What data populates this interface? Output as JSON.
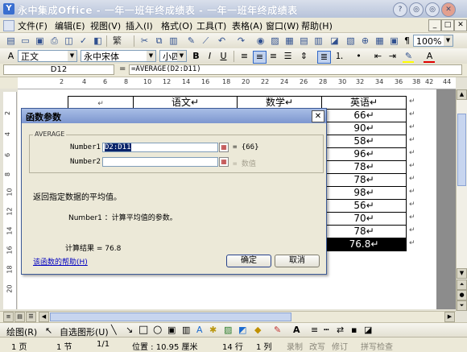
{
  "window": {
    "title": "永中集成Office - 一年一班年终成绩表 - 一年一班年终成绩表",
    "buttons": [
      "?",
      "◎",
      "◎",
      "✕"
    ]
  },
  "menubar": {
    "items": [
      "文件(F)",
      "编辑(E)",
      "视图(V)",
      "插入(I)",
      "格式(O)",
      "工具(T)",
      "表格(A)",
      "窗口(W)",
      "帮助(H)"
    ]
  },
  "toolbar": {
    "zoom": "100%",
    "style": "正文",
    "font": "永中宋体",
    "size": "小四"
  },
  "formula_bar": {
    "cell_ref": "D12",
    "equals": "=",
    "formula": "=AVERAGE(D2:D11)"
  },
  "ruler": {
    "numbers": [
      "2",
      "4",
      "6",
      "8",
      "10",
      "12",
      "14",
      "16",
      "18",
      "20",
      "22",
      "24",
      "26",
      "28",
      "30",
      "32",
      "34",
      "36",
      "38",
      "42",
      "44"
    ],
    "vnumbers": [
      "2",
      "4",
      "6",
      "8",
      "10",
      "12",
      "14",
      "16",
      "18",
      "20"
    ]
  },
  "table": {
    "header": [
      "↵",
      "语文↵",
      "数学↵",
      "英语↵"
    ],
    "english_scores": [
      "66↵",
      "90↵",
      "58↵",
      "96↵",
      "78↵",
      "78↵",
      "98↵",
      "56↵",
      "70↵",
      "78↵"
    ],
    "result": "76.8↵"
  },
  "dialog": {
    "title": "函数参数",
    "close": "✕",
    "function_name": "AVERAGE",
    "arg1_label": "Number1",
    "arg1_value": "D2:D11",
    "arg1_result": "= {66}",
    "arg2_label": "Number2",
    "arg2_result": "= 数值",
    "description": "返回指定数据的平均值。",
    "arg_description": "Number1 ：计算平均值的参数。",
    "result_label": "计算结果 = 76.8",
    "help_link": "该函数的帮助(H)",
    "ok": "确定",
    "cancel": "取消"
  },
  "drawbar": {
    "draw": "绘图(R)",
    "autoshapes": "自选图形(U)"
  },
  "statusbar": {
    "page": "1 页",
    "section": "1 节",
    "page_of": "1/1",
    "position": "位置 : 10.95 厘米",
    "line": "14 行",
    "col": "1 列",
    "rec": "录制",
    "trk": "改写",
    "ext": "修订",
    "spell": "拼写检查"
  }
}
